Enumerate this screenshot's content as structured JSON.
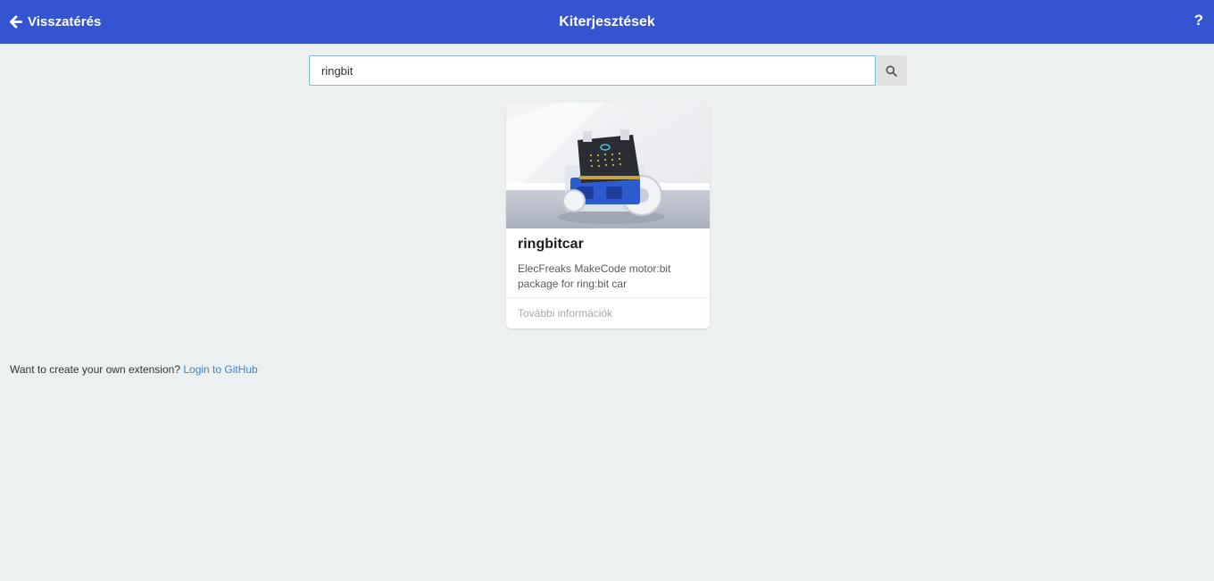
{
  "header": {
    "back_label": "Visszatérés",
    "title": "Kiterjesztések",
    "help_label": "?",
    "background": "#3454d1"
  },
  "search": {
    "value": "ringbit",
    "button_icon": "search-icon"
  },
  "results": [
    {
      "name": "ringbitcar",
      "description": "ElecFreaks MakeCode motor:bit package for ring:bit car",
      "more_label": "További információk",
      "image_icon": "robot-car-image"
    }
  ],
  "footer": {
    "prompt": "Want to create your own extension?",
    "link": "Login to GitHub",
    "link_color": "#4183c4"
  }
}
